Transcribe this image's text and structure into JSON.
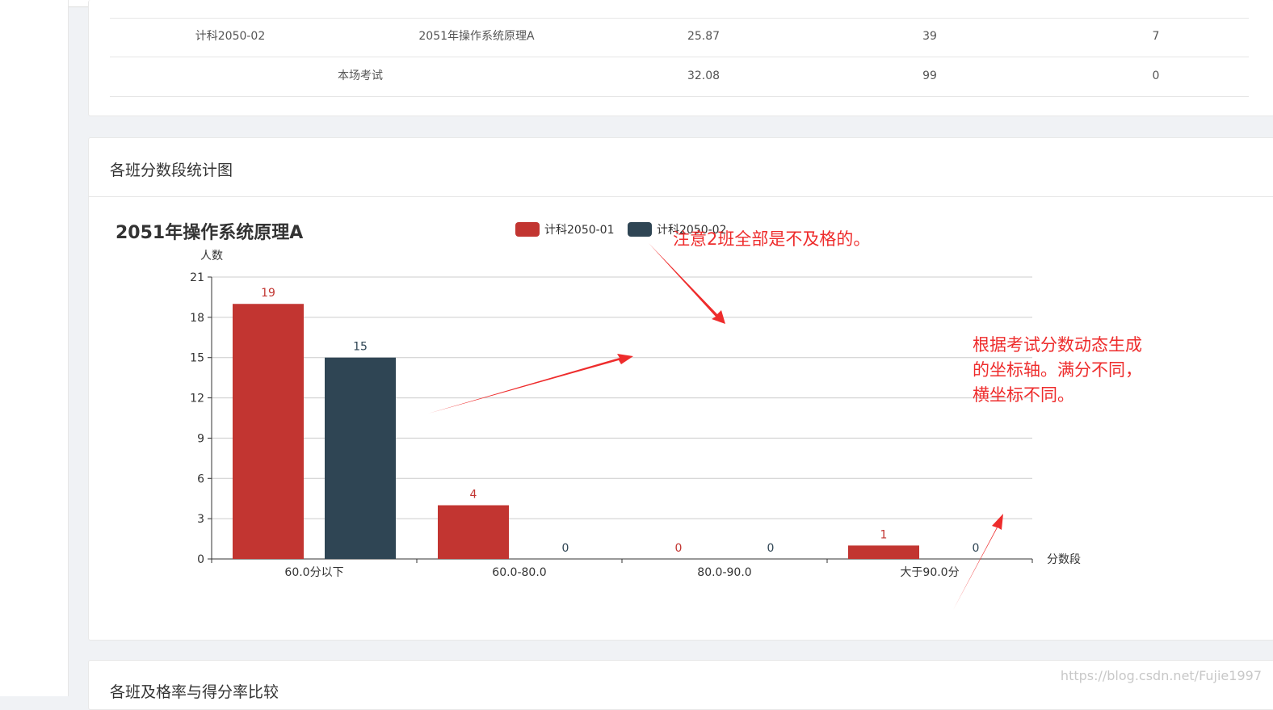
{
  "score_table": {
    "rows": [
      {
        "class": "计科2050-02",
        "course": "2051年操作系统原理A",
        "avg": "25.87",
        "count": "39",
        "pass": "7"
      },
      {
        "label": "本场考试",
        "avg": "32.08",
        "count": "99",
        "pass": "0"
      }
    ]
  },
  "chart_card": {
    "section_title": "各班分数段统计图"
  },
  "chart_data": {
    "type": "bar",
    "title": "2051年操作系统原理A",
    "ylabel": "人数",
    "xlabel": "分数段",
    "categories": [
      "60.0分以下",
      "60.0-80.0",
      "80.0-90.0",
      "大于90.0分"
    ],
    "ylim": [
      0,
      21
    ],
    "yticks": [
      0,
      3,
      6,
      9,
      12,
      15,
      18,
      21
    ],
    "series": [
      {
        "name": "计科2050-01",
        "values": [
          19,
          4,
          0,
          1
        ],
        "color": "#c23531"
      },
      {
        "name": "计科2050-02",
        "values": [
          15,
          0,
          0,
          0
        ],
        "color": "#2f4554"
      }
    ],
    "grid": true,
    "legend": "top"
  },
  "annotations": {
    "note1": "注意2班全部是不及格的。",
    "note2_lines": [
      "根据考试分数动态生成",
      "的坐标轴。满分不同，",
      "横坐标不同。"
    ],
    "arrow_color": "#ee2c2c"
  },
  "next_card": {
    "section_title": "各班及格率与得分率比较"
  },
  "watermark": "https://blog.csdn.net/Fujie1997"
}
